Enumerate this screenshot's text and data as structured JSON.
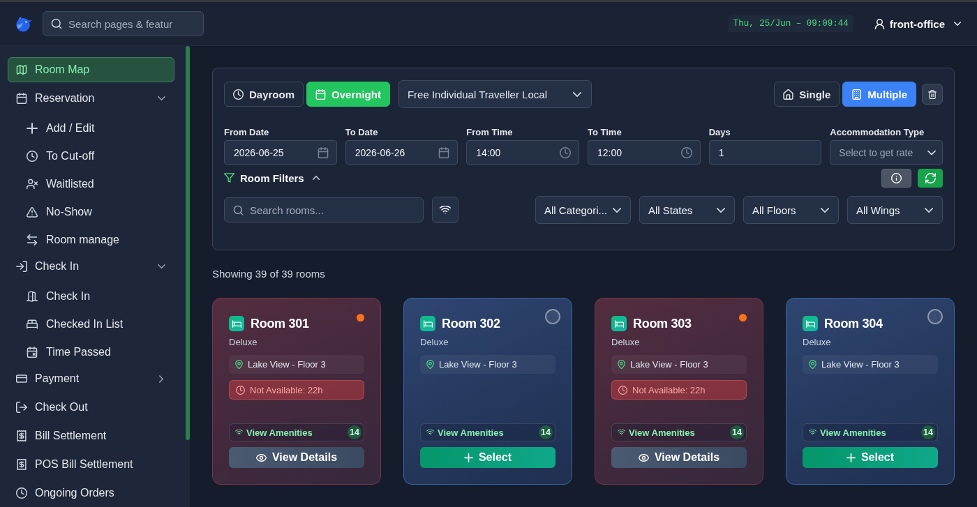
{
  "topbar": {
    "search": {
      "placeholder": "Search pages & featur"
    },
    "clock": "Thu, 25/Jun – 09:09:44",
    "user": "front-office"
  },
  "sidebar": {
    "items": [
      {
        "label": "Room Map",
        "selected": true
      },
      {
        "label": "Reservation",
        "selected": false,
        "expanded": true,
        "children": [
          {
            "label": "Add / Edit",
            "selected": false
          },
          {
            "label": "To Cut-off",
            "selected": false
          },
          {
            "label": "Waitlisted",
            "selected": false
          },
          {
            "label": "No-Show",
            "selected": false
          },
          {
            "label": "Room manage",
            "selected": false
          }
        ]
      },
      {
        "label": "Check In",
        "selected": false,
        "expanded": true,
        "children": [
          {
            "label": "Check In",
            "selected": false
          },
          {
            "label": "Checked In List",
            "selected": false
          },
          {
            "label": "Time Passed",
            "selected": false
          }
        ]
      },
      {
        "label": "Payment",
        "selected": false,
        "expanded": false
      },
      {
        "label": "Check Out",
        "selected": false
      },
      {
        "label": "Bill Settlement",
        "selected": false
      },
      {
        "label": "POS Bill Settlement",
        "selected": false
      },
      {
        "label": "Ongoing Orders",
        "selected": false
      }
    ]
  },
  "booking_panel": {
    "stay_types": [
      {
        "label": "Dayroom",
        "selected": false
      },
      {
        "label": "Overnight",
        "selected": true
      }
    ],
    "guest_type": {
      "value": "Free Individual Traveller Local"
    },
    "room_modes": [
      {
        "label": "Single",
        "selected": false
      },
      {
        "label": "Multiple",
        "selected": true
      }
    ],
    "fields": [
      {
        "kind": "date",
        "label": "From Date",
        "value": "2026-06-25"
      },
      {
        "kind": "date",
        "label": "To Date",
        "value": "2026-06-26"
      },
      {
        "kind": "time",
        "label": "From Time",
        "value": "14:00"
      },
      {
        "kind": "time",
        "label": "To Time",
        "value": "12:00"
      },
      {
        "kind": "number",
        "label": "Days",
        "value": "1"
      },
      {
        "kind": "select",
        "label": "Accommodation Type",
        "placeholder": "Select to get rate"
      }
    ],
    "room_filters": {
      "label": "Room Filters",
      "expanded": true,
      "search": {
        "placeholder": "Search rooms..."
      },
      "selects": [
        {
          "value": "All Categori..."
        },
        {
          "value": "All States"
        },
        {
          "value": "All Floors"
        },
        {
          "value": "All Wings"
        }
      ]
    }
  },
  "results_summary": "Showing 39 of 39 rooms",
  "rooms": [
    {
      "kind": "occupied",
      "name": "Room 301",
      "category": "Deluxe",
      "location": "Lake View - Floor 3",
      "availability": "Not Available: 22h",
      "color": "#f97316",
      "amenities": {
        "label": "View Amenities",
        "count": "14"
      },
      "action": "View Details"
    },
    {
      "kind": "available",
      "name": "Room 302",
      "category": "Deluxe",
      "location": "Lake View - Floor 3",
      "selected": false,
      "amenities": {
        "label": "View Amenities",
        "count": "14"
      },
      "action": "Select"
    },
    {
      "kind": "occupied",
      "name": "Room 303",
      "category": "Deluxe",
      "location": "Lake View - Floor 3",
      "availability": "Not Available: 22h",
      "color": "#f97316",
      "amenities": {
        "label": "View Amenities",
        "count": "14"
      },
      "action": "View Details"
    },
    {
      "kind": "available",
      "name": "Room 304",
      "category": "Deluxe",
      "location": "Lake View - Floor 3",
      "selected": false,
      "amenities": {
        "label": "View Amenities",
        "count": "14"
      },
      "action": "Select"
    }
  ]
}
